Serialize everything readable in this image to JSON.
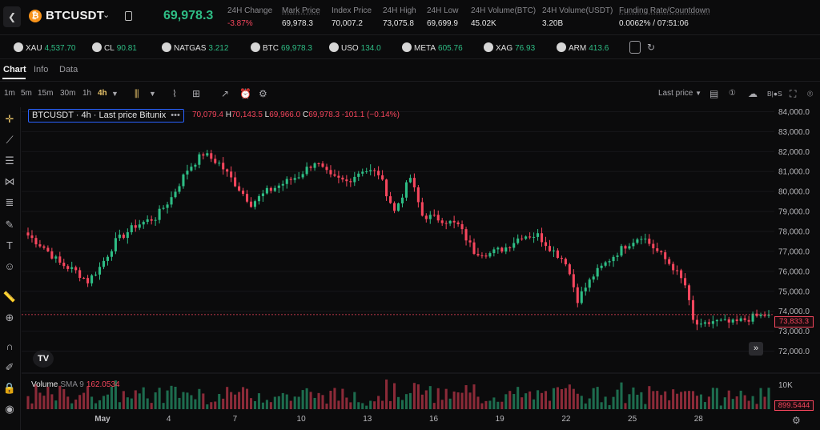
{
  "header": {
    "back_icon": "chevron-left-icon",
    "coin_glyph": "₿",
    "symbol": "BTCUSDT",
    "last_price": "69,978.3",
    "stats": [
      {
        "label": "24H Change",
        "value": "-3.87%",
        "tone": "red",
        "underline": false
      },
      {
        "label": "Mark Price",
        "value": "69,978.3",
        "tone": "neutral",
        "underline": true
      },
      {
        "label": "Index Price",
        "value": "70,007.2",
        "tone": "neutral",
        "underline": false
      },
      {
        "label": "24H High",
        "value": "73,075.8",
        "tone": "neutral",
        "underline": false
      },
      {
        "label": "24H Low",
        "value": "69,699.9",
        "tone": "neutral",
        "underline": false
      },
      {
        "label": "24H Volume(BTC)",
        "value": "45.02K",
        "tone": "neutral",
        "underline": false
      },
      {
        "label": "24H Volume(USDT)",
        "value": "3.20B",
        "tone": "neutral",
        "underline": false
      }
    ],
    "funding": {
      "label": "Funding Rate/Countdown",
      "rate": "0.0062%",
      "sep": " / ",
      "countdown": "07:51:06"
    }
  },
  "tickers": [
    {
      "name": "XAU",
      "value": "4,537.70"
    },
    {
      "name": "CL",
      "value": "90.81"
    },
    {
      "name": "NATGAS",
      "value": "3.212"
    },
    {
      "name": "BTC",
      "value": "69,978.3"
    },
    {
      "name": "USO",
      "value": "134.0"
    },
    {
      "name": "META",
      "value": "605.76"
    },
    {
      "name": "XAG",
      "value": "76.93"
    },
    {
      "name": "ARM",
      "value": "413.6"
    }
  ],
  "tabs": [
    "Chart",
    "Info",
    "Data"
  ],
  "timeframes": [
    "1m",
    "5m",
    "15m",
    "30m",
    "1h",
    "4h"
  ],
  "active_timeframe": "4h",
  "toolbar": {
    "last_price_dropdown": "Last price",
    "bos_label": "B|●S"
  },
  "chart": {
    "legend": "BTCUSDT · 4h · Last price Bitunix",
    "legend_more": "•••",
    "ohlc": {
      "o": "70,079.4",
      "h": "70,143.5",
      "l": "69,966.0",
      "c": "69,978.3",
      "chg": "-101.1 (−0.14%)"
    },
    "volume_legend": {
      "label": "Volume",
      "sma": "SMA 9",
      "value": "162.0534"
    },
    "price_tag": "73,833.3",
    "volume_tag": "899.5444",
    "volume_axis_label": "10K",
    "logo_text": "TV"
  },
  "chart_data": {
    "type": "candlestick",
    "y_ticks": [
      84000,
      83000,
      82000,
      81000,
      80000,
      79000,
      78000,
      77000,
      76000,
      75000,
      74000,
      73000,
      72000
    ],
    "y_tick_labels": [
      "84,000.0",
      "83,000.0",
      "82,000.0",
      "81,000.0",
      "80,000.0",
      "79,000.0",
      "78,000.0",
      "77,000.0",
      "76,000.0",
      "75,000.0",
      "74,000.0",
      "73,000.0",
      "72,000.0"
    ],
    "ylim": [
      71500,
      84300
    ],
    "x_labels": [
      "May",
      "4",
      "7",
      "10",
      "13",
      "16",
      "19",
      "22",
      "25",
      "28"
    ],
    "series": [
      {
        "anchors": [
          [
            0,
            77800
          ],
          [
            4,
            77200
          ],
          [
            8,
            76400
          ],
          [
            12,
            76000
          ],
          [
            15,
            75500
          ],
          [
            18,
            76200
          ],
          [
            22,
            77500
          ],
          [
            27,
            78300
          ],
          [
            32,
            78700
          ],
          [
            36,
            79700
          ],
          [
            40,
            81100
          ],
          [
            44,
            81900
          ],
          [
            48,
            81400
          ],
          [
            52,
            80400
          ],
          [
            56,
            79400
          ],
          [
            60,
            80000
          ],
          [
            64,
            80400
          ],
          [
            68,
            80800
          ],
          [
            72,
            81500
          ],
          [
            76,
            80700
          ],
          [
            80,
            80500
          ],
          [
            84,
            81100
          ],
          [
            88,
            80900
          ],
          [
            92,
            79000
          ],
          [
            96,
            80700
          ],
          [
            99,
            78800
          ],
          [
            104,
            78600
          ],
          [
            108,
            78300
          ],
          [
            112,
            77000
          ],
          [
            116,
            76900
          ],
          [
            120,
            77200
          ],
          [
            124,
            77800
          ],
          [
            128,
            77800
          ],
          [
            132,
            77000
          ],
          [
            135,
            76500
          ],
          [
            138,
            74600
          ],
          [
            142,
            75800
          ],
          [
            146,
            76600
          ],
          [
            150,
            77300
          ],
          [
            154,
            77800
          ],
          [
            158,
            77000
          ],
          [
            162,
            76200
          ],
          [
            165,
            75300
          ],
          [
            167,
            73500
          ],
          [
            169,
            73200
          ],
          [
            172,
            73500
          ],
          [
            177,
            73400
          ],
          [
            182,
            73700
          ],
          [
            186,
            73850
          ]
        ],
        "count": 187,
        "last_close": 73833.3
      }
    ]
  },
  "colors": {
    "up": "#2ebd85",
    "down": "#f6465d",
    "accent": "#e9c46a",
    "legend_border": "#2962ff",
    "background": "#0b0b0c"
  }
}
